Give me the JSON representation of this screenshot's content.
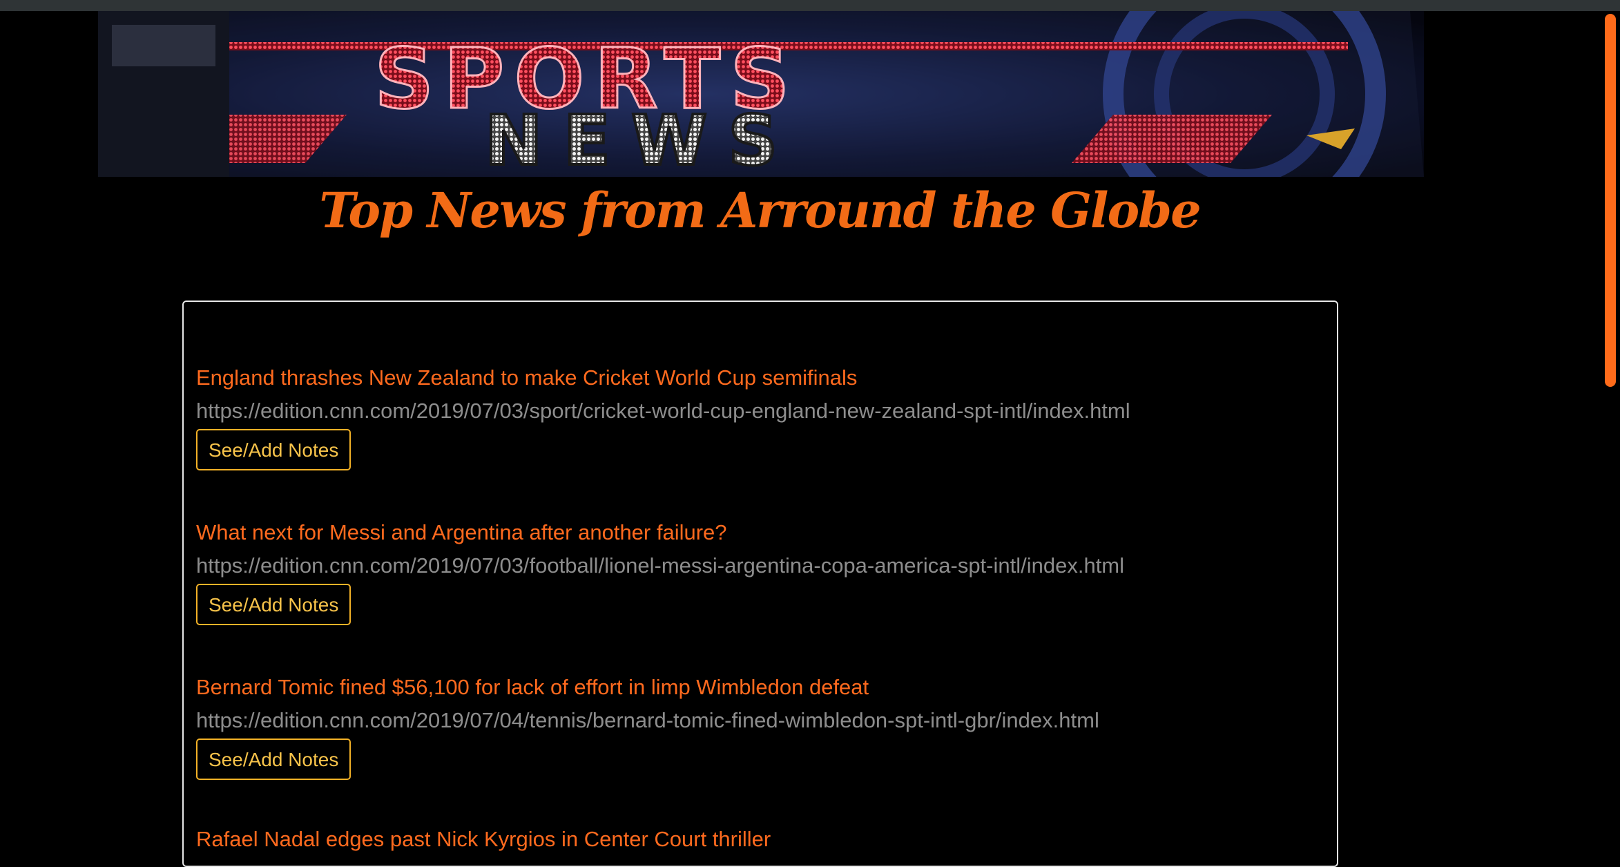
{
  "banner": {
    "logo_top": "SPORTS",
    "logo_bottom": "NEWS"
  },
  "page_title": "Top News from Arround the Globe",
  "colors": {
    "accent": "#f26b16",
    "button_border": "#f4b227",
    "link_gray": "#8d8d8d",
    "background": "#000000"
  },
  "articles": [
    {
      "title": "England thrashes New Zealand to make Cricket World Cup semifinals",
      "link": "https://edition.cnn.com/2019/07/03/sport/cricket-world-cup-england-new-zealand-spt-intl/index.html",
      "button": "See/Add Notes"
    },
    {
      "title": "What next for Messi and Argentina after another failure?",
      "link": "https://edition.cnn.com/2019/07/03/football/lionel-messi-argentina-copa-america-spt-intl/index.html",
      "button": "See/Add Notes"
    },
    {
      "title": "Bernard Tomic fined $56,100 for lack of effort in limp Wimbledon defeat",
      "link": "https://edition.cnn.com/2019/07/04/tennis/bernard-tomic-fined-wimbledon-spt-intl-gbr/index.html",
      "button": "See/Add Notes"
    },
    {
      "title": "Rafael Nadal edges past Nick Kyrgios in Center Court thriller",
      "link": "",
      "button": ""
    }
  ]
}
